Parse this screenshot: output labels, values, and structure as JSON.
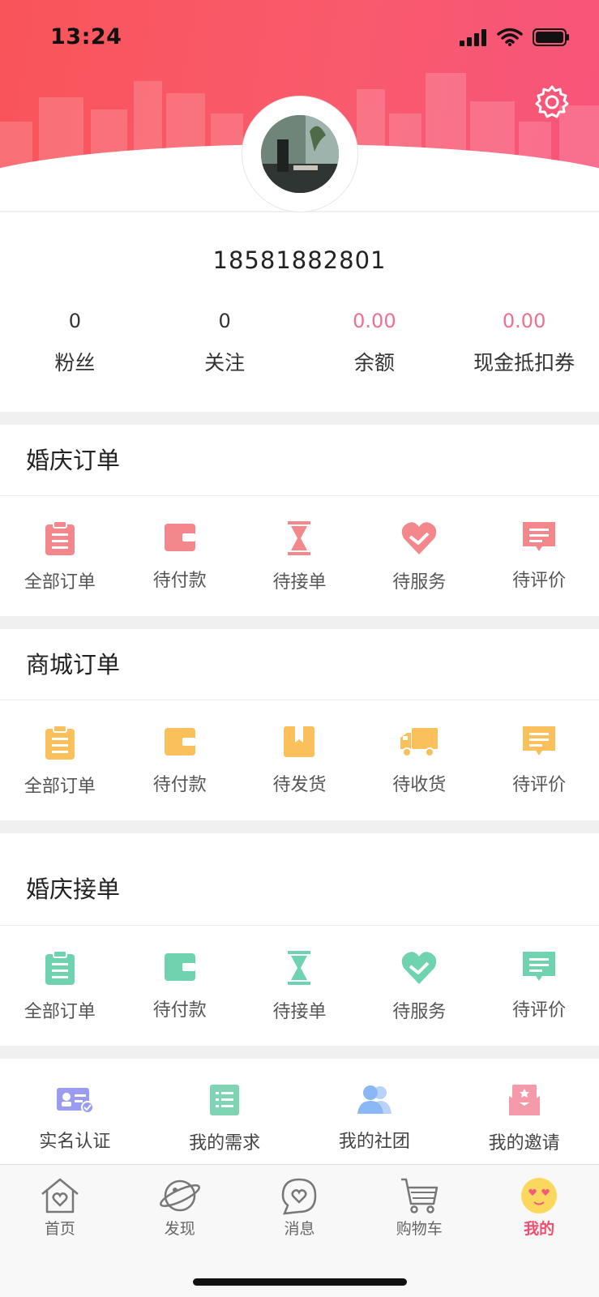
{
  "status_bar": {
    "time": "13:24"
  },
  "profile": {
    "phone": "18581882801",
    "stats": [
      {
        "value": "0",
        "label": "粉丝",
        "highlight": false
      },
      {
        "value": "0",
        "label": "关注",
        "highlight": false
      },
      {
        "value": "0.00",
        "label": "余额",
        "highlight": true
      },
      {
        "value": "0.00",
        "label": "现金抵扣券",
        "highlight": true
      }
    ]
  },
  "wedding_orders": {
    "title": "婚庆订单",
    "color": "#f4878c",
    "items": [
      {
        "label": "全部订单",
        "icon": "clipboard-icon"
      },
      {
        "label": "待付款",
        "icon": "wallet-icon"
      },
      {
        "label": "待接单",
        "icon": "hourglass-icon"
      },
      {
        "label": "待服务",
        "icon": "handshake-heart-icon"
      },
      {
        "label": "待评价",
        "icon": "comment-icon"
      }
    ]
  },
  "mall_orders": {
    "title": "商城订单",
    "color": "#f9c05c",
    "items": [
      {
        "label": "全部订单",
        "icon": "clipboard-icon"
      },
      {
        "label": "待付款",
        "icon": "wallet-icon"
      },
      {
        "label": "待发货",
        "icon": "box-icon"
      },
      {
        "label": "待收货",
        "icon": "truck-icon"
      },
      {
        "label": "待评价",
        "icon": "comment-icon"
      }
    ]
  },
  "wedding_accept": {
    "title": "婚庆接单",
    "color": "#6fd3b0",
    "items": [
      {
        "label": "全部订单",
        "icon": "clipboard-icon"
      },
      {
        "label": "待付款",
        "icon": "wallet-icon"
      },
      {
        "label": "待接单",
        "icon": "hourglass-icon"
      },
      {
        "label": "待服务",
        "icon": "handshake-heart-icon"
      },
      {
        "label": "待评价",
        "icon": "comment-icon"
      }
    ]
  },
  "tools": [
    {
      "label": "实名认证",
      "icon": "id-card-icon",
      "color": "#9a9cf0"
    },
    {
      "label": "我的需求",
      "icon": "list-icon",
      "color": "#7fd4b3"
    },
    {
      "label": "我的社团",
      "icon": "group-icon",
      "color": "#8ab8f5"
    },
    {
      "label": "我的邀请",
      "icon": "invitation-icon",
      "color": "#f59aa8"
    }
  ],
  "tabbar": {
    "tabs": [
      {
        "label": "首页",
        "icon": "home-icon",
        "active": false
      },
      {
        "label": "发现",
        "icon": "planet-icon",
        "active": false
      },
      {
        "label": "消息",
        "icon": "message-icon",
        "active": false
      },
      {
        "label": "购物车",
        "icon": "cart-icon",
        "active": false
      },
      {
        "label": "我的",
        "icon": "emoji-face-icon",
        "active": true
      }
    ]
  }
}
